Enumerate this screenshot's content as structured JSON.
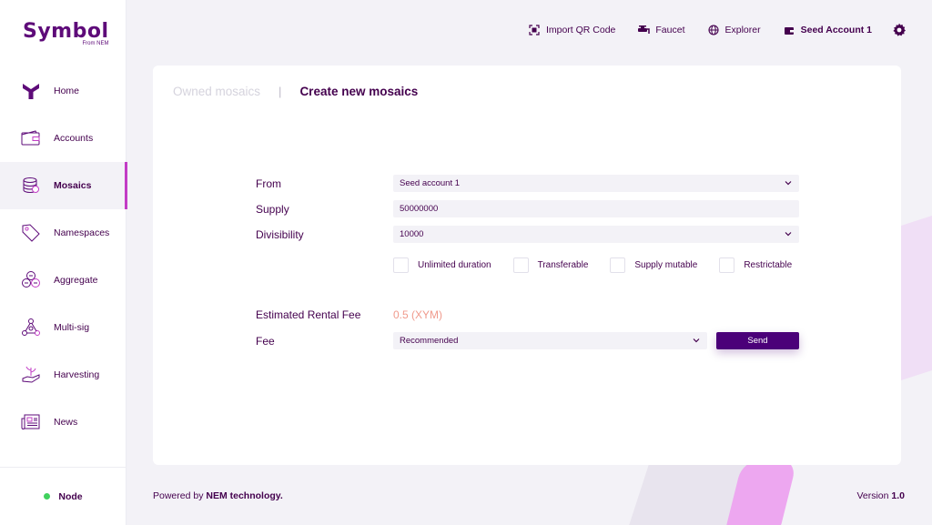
{
  "brand": {
    "name": "Symbol",
    "tagline": "From NEM"
  },
  "sidebar": {
    "items": [
      {
        "label": "Home",
        "icon": "home-icon"
      },
      {
        "label": "Accounts",
        "icon": "wallet-icon"
      },
      {
        "label": "Mosaics",
        "icon": "coins-icon",
        "active": true
      },
      {
        "label": "Namespaces",
        "icon": "tag-icon"
      },
      {
        "label": "Aggregate",
        "icon": "aggregate-icon"
      },
      {
        "label": "Multi-sig",
        "icon": "multisig-icon"
      },
      {
        "label": "Harvesting",
        "icon": "harvesting-icon"
      },
      {
        "label": "News",
        "icon": "news-icon"
      }
    ],
    "node": {
      "label": "Node",
      "status_color": "#40d15d"
    }
  },
  "topbar": {
    "import_qr": "Import QR Code",
    "faucet": "Faucet",
    "explorer": "Explorer",
    "account": "Seed Account 1"
  },
  "tabs": {
    "owned": "Owned mosaics",
    "create": "Create new mosaics"
  },
  "form": {
    "from_label": "From",
    "from_value": "Seed account 1",
    "supply_label": "Supply",
    "supply_value": "50000000",
    "divisibility_label": "Divisibility",
    "divisibility_value": "10000",
    "checkboxes": [
      {
        "label": "Unlimited duration",
        "checked": false
      },
      {
        "label": "Transferable",
        "checked": false
      },
      {
        "label": "Supply mutable",
        "checked": false
      },
      {
        "label": "Restrictable",
        "checked": false
      }
    ],
    "rental_fee_label": "Estimated Rental Fee",
    "rental_fee_value": "0.5 (XYM)",
    "fee_label": "Fee",
    "fee_value": "Recommended",
    "send_label": "Send"
  },
  "footer": {
    "powered_prefix": "Powered by ",
    "powered_brand": "NEM technology.",
    "version_prefix": "Version ",
    "version_value": "1.0"
  },
  "colors": {
    "accent": "#5e0b79",
    "primary_button": "#4b0079",
    "highlight": "#c23cc5",
    "rental_fee": "#f09a8c"
  }
}
